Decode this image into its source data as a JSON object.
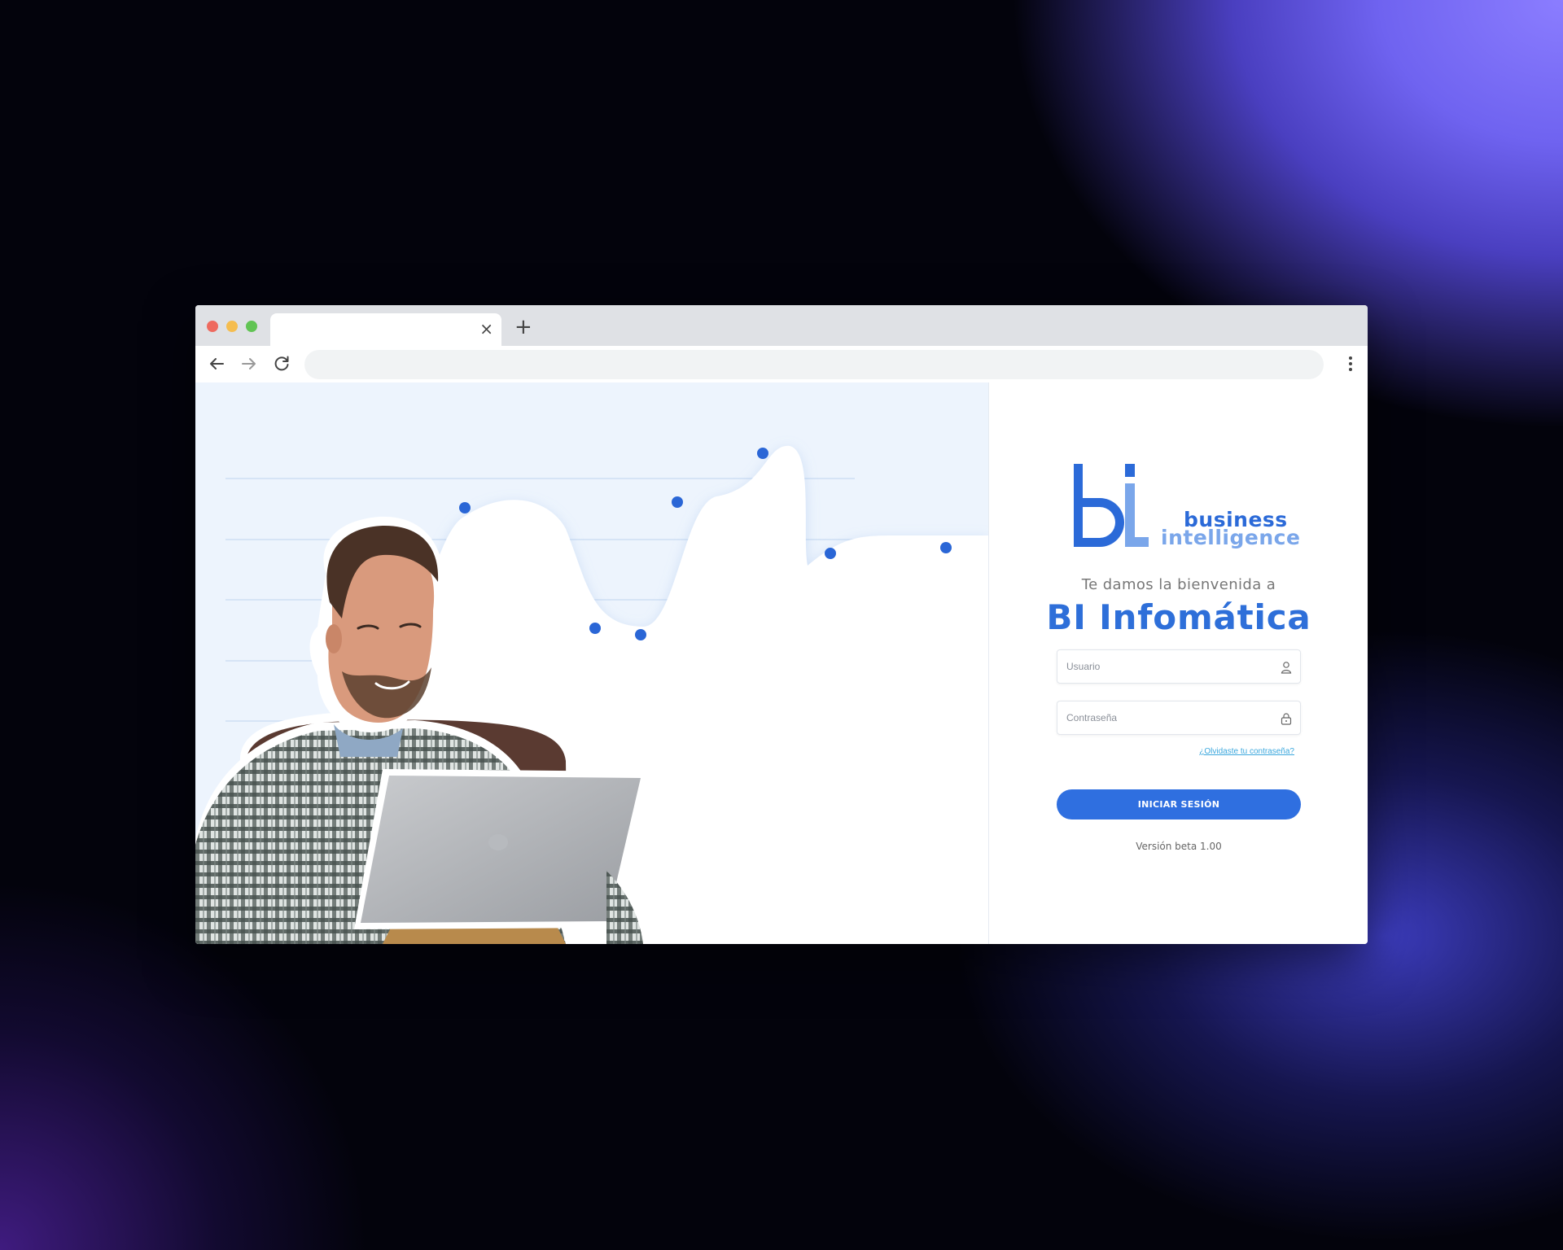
{
  "browser": {
    "tab_title": "",
    "tab_close_glyph": "×",
    "new_tab_glyph": "+",
    "address": "",
    "icons": [
      "back-arrow-icon",
      "forward-arrow-icon",
      "reload-icon",
      "more-vertical-icon",
      "close-icon",
      "plus-icon"
    ]
  },
  "login": {
    "logo_text_line1": "business",
    "logo_text_line2": "intelligence",
    "welcome": "Te damos la bienvenida a",
    "brand": "BI Infomática",
    "username_placeholder": "Usuario",
    "username_value": "",
    "password_placeholder": "Contraseña",
    "password_value": "",
    "forgot_link": "¿Olvidaste tu contraseña?",
    "submit_label": "INICIAR SESIÓN",
    "version": "Versión beta 1.00"
  },
  "colors": {
    "accent": "#2f6fe0",
    "brand_text": "#2e6fd9",
    "left_panel_bg": "#edf4fd",
    "chart_dot": "#2a66d6",
    "link": "#3aa7dd"
  }
}
